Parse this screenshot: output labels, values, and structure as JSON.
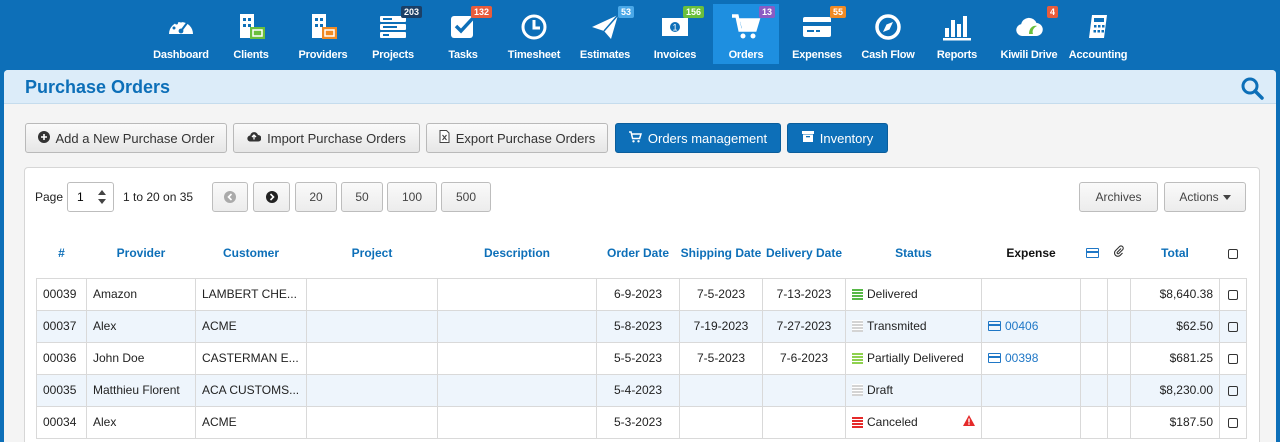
{
  "nav": [
    {
      "key": "dashboard",
      "label": "Dashboard",
      "icon": "dashboard-icon",
      "badge": "",
      "badge_color": ""
    },
    {
      "key": "clients",
      "label": "Clients",
      "icon": "clients-icon",
      "badge": "",
      "badge_color": ""
    },
    {
      "key": "providers",
      "label": "Providers",
      "icon": "providers-icon",
      "badge": "",
      "badge_color": ""
    },
    {
      "key": "projects",
      "label": "Projects",
      "icon": "projects-icon",
      "badge": "203",
      "badge_color": "#1b3f66"
    },
    {
      "key": "tasks",
      "label": "Tasks",
      "icon": "tasks-icon",
      "badge": "132",
      "badge_color": "#e85c3c"
    },
    {
      "key": "timesheet",
      "label": "Timesheet",
      "icon": "timesheet-icon",
      "badge": "",
      "badge_color": ""
    },
    {
      "key": "estimates",
      "label": "Estimates",
      "icon": "estimates-icon",
      "badge": "53",
      "badge_color": "#4aa8e8"
    },
    {
      "key": "invoices",
      "label": "Invoices",
      "icon": "invoices-icon",
      "badge": "156",
      "badge_color": "#6abf3c"
    },
    {
      "key": "orders",
      "label": "Orders",
      "icon": "orders-icon",
      "badge": "13",
      "badge_color": "#8a5cc4"
    },
    {
      "key": "expenses",
      "label": "Expenses",
      "icon": "expenses-icon",
      "badge": "55",
      "badge_color": "#f08a24"
    },
    {
      "key": "cashflow",
      "label": "Cash Flow",
      "icon": "cashflow-icon",
      "badge": "",
      "badge_color": ""
    },
    {
      "key": "reports",
      "label": "Reports",
      "icon": "reports-icon",
      "badge": "",
      "badge_color": ""
    },
    {
      "key": "kiwili-drive",
      "label": "Kiwili Drive",
      "icon": "cloud-icon",
      "badge": "4",
      "badge_color": "#e85c3c"
    },
    {
      "key": "accounting",
      "label": "Accounting",
      "icon": "accounting-icon",
      "badge": "",
      "badge_color": ""
    }
  ],
  "active_nav": "orders",
  "page": {
    "title": "Purchase Orders"
  },
  "toolbar": {
    "add": "Add a New Purchase Order",
    "import": "Import Purchase Orders",
    "export": "Export Purchase Orders",
    "manage": "Orders management",
    "inventory": "Inventory"
  },
  "pager": {
    "page_label": "Page",
    "page_value": "1",
    "range": "1 to 20 on 35",
    "sizes": [
      "20",
      "50",
      "100",
      "500"
    ]
  },
  "actions": {
    "archives": "Archives",
    "actions": "Actions"
  },
  "columns": {
    "num": "#",
    "provider": "Provider",
    "customer": "Customer",
    "project": "Project",
    "description": "Description",
    "order_date": "Order Date",
    "shipping_date": "Shipping Date",
    "delivery_date": "Delivery Date",
    "status": "Status",
    "expense": "Expense",
    "total": "Total"
  },
  "rows": [
    {
      "num": "00039",
      "provider": "Amazon",
      "customer": "LAMBERT CHE...",
      "project": "",
      "description": "",
      "order_date": "6-9-2023",
      "shipping_date": "7-5-2023",
      "delivery_date": "7-13-2023",
      "status": "Delivered",
      "status_class": "st-delivered",
      "expense": "",
      "warning": false,
      "total": "$8,640.38"
    },
    {
      "num": "00037",
      "provider": "Alex",
      "customer": "ACME",
      "project": "",
      "description": "",
      "order_date": "5-8-2023",
      "shipping_date": "7-19-2023",
      "delivery_date": "7-27-2023",
      "status": "Transmited",
      "status_class": "st-trans",
      "expense": "00406",
      "warning": false,
      "total": "$62.50"
    },
    {
      "num": "00036",
      "provider": "John Doe",
      "customer": "CASTERMAN E...",
      "project": "",
      "description": "",
      "order_date": "5-5-2023",
      "shipping_date": "7-5-2023",
      "delivery_date": "7-6-2023",
      "status": "Partially Delivered",
      "status_class": "st-partial",
      "expense": "00398",
      "warning": false,
      "total": "$681.25"
    },
    {
      "num": "00035",
      "provider": "Matthieu Florent",
      "customer": "ACA CUSTOMS...",
      "project": "",
      "description": "",
      "order_date": "5-4-2023",
      "shipping_date": "",
      "delivery_date": "",
      "status": "Draft",
      "status_class": "st-draft",
      "expense": "",
      "warning": false,
      "total": "$8,230.00"
    },
    {
      "num": "00034",
      "provider": "Alex",
      "customer": "ACME",
      "project": "",
      "description": "",
      "order_date": "5-3-2023",
      "shipping_date": "",
      "delivery_date": "",
      "status": "Canceled",
      "status_class": "st-cancel",
      "expense": "",
      "warning": true,
      "total": "$187.50"
    }
  ],
  "colors": {
    "brand": "#0d6fb8",
    "header_bg": "#dcecf9",
    "row_alt": "#eef5fc",
    "link": "#1f77c6"
  }
}
